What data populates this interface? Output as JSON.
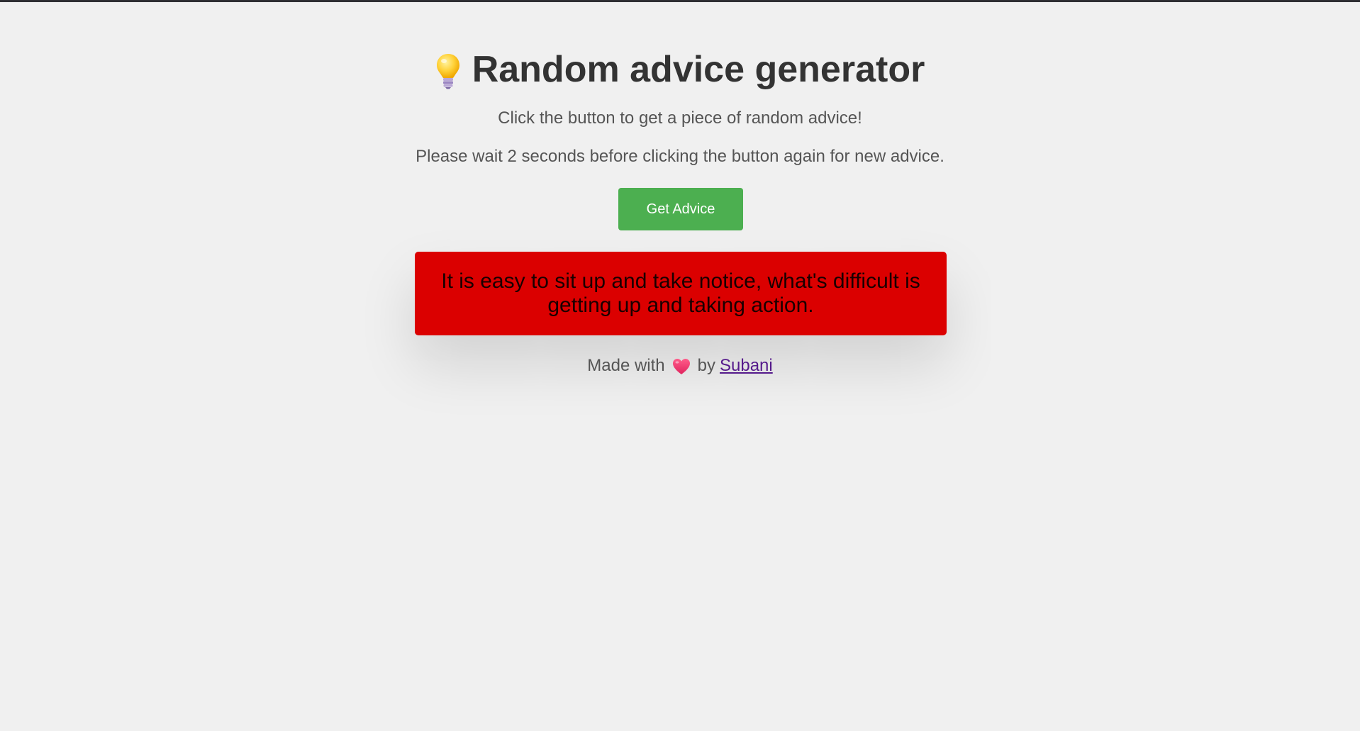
{
  "header": {
    "title": "Random advice generator",
    "icon": "lightbulb-icon"
  },
  "instructions": {
    "line1": "Click the button to get a piece of random advice!",
    "line2": "Please wait 2 seconds before clicking the button again for new advice."
  },
  "actions": {
    "get_advice_label": "Get Advice"
  },
  "advice": {
    "text": "It is easy to sit up and take notice, what's difficult is getting up and taking action."
  },
  "footer": {
    "made_with": "Made with",
    "icon": "heart-icon",
    "by": "by",
    "author": "Subani"
  },
  "colors": {
    "background": "#f0f0f0",
    "button": "#4caf50",
    "advice_card": "#db0000",
    "link": "#551a8b"
  }
}
